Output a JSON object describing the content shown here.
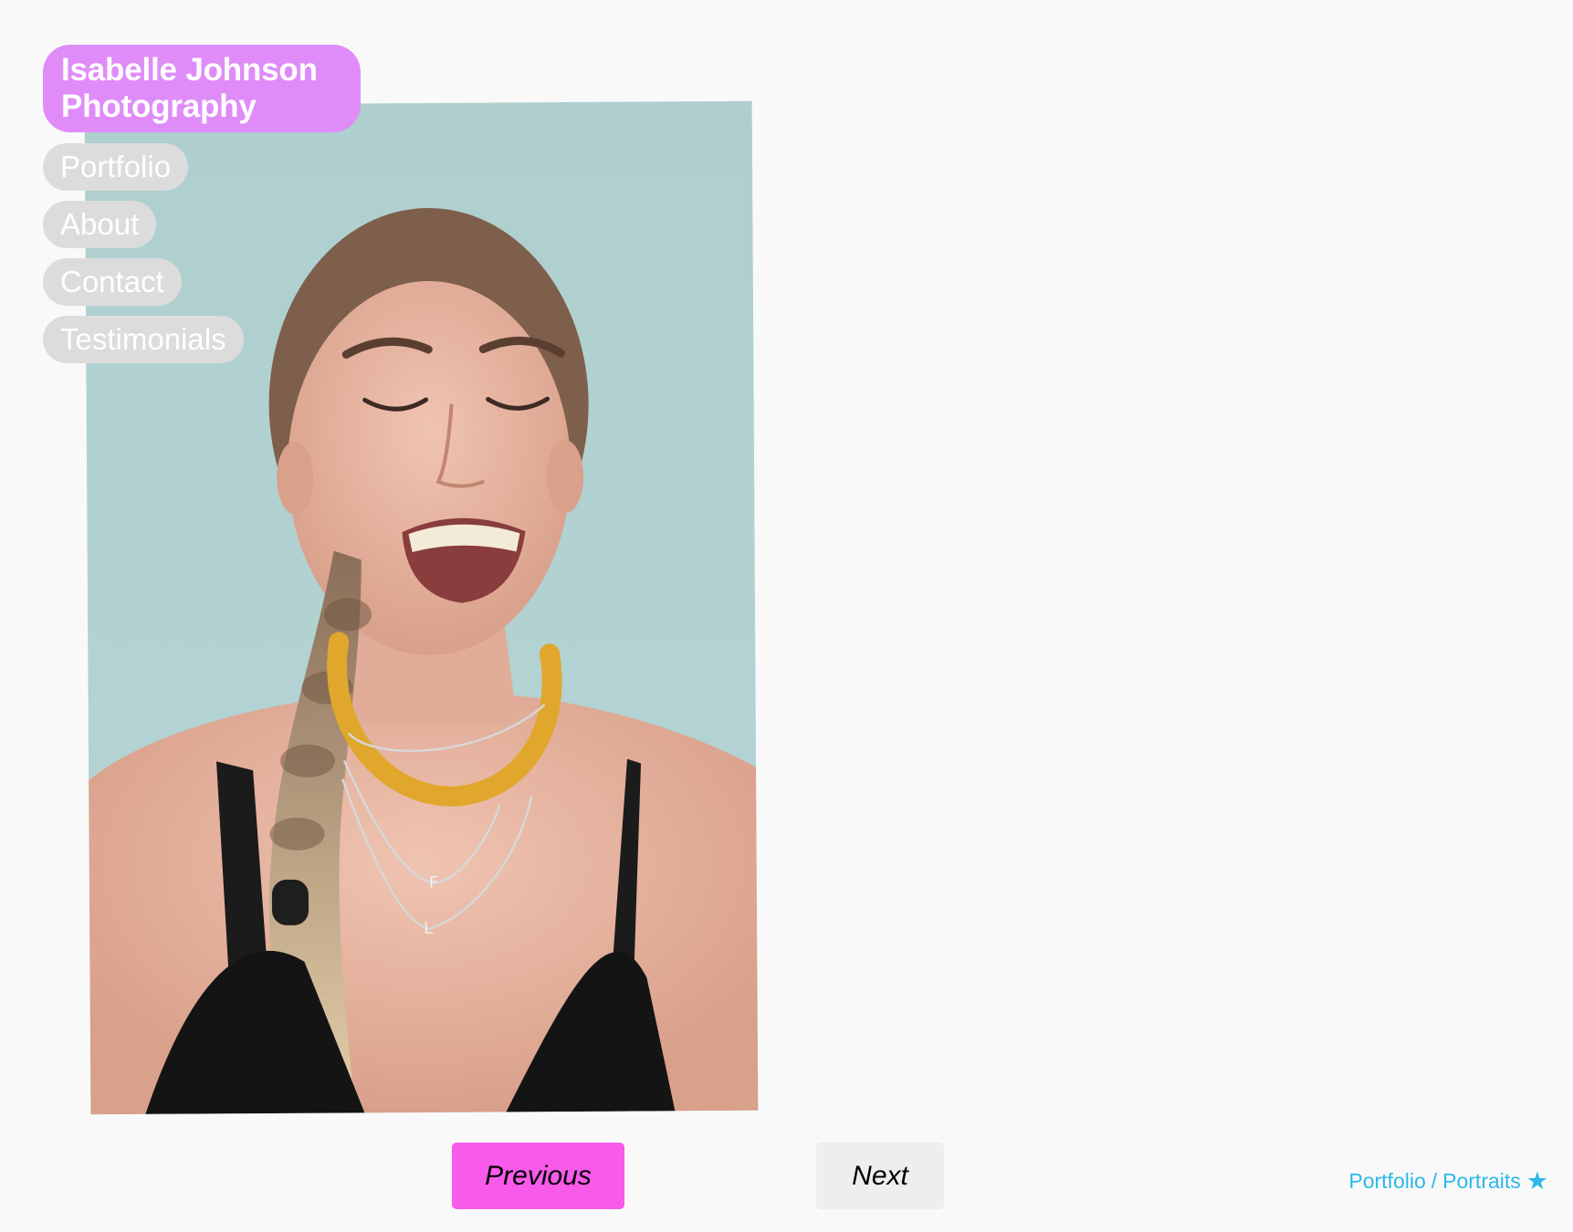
{
  "site": {
    "title": "Isabelle Johnson Photography",
    "title_color": "#df8cf8"
  },
  "nav": {
    "items": [
      {
        "label": "Portfolio"
      },
      {
        "label": "About"
      },
      {
        "label": "Contact"
      },
      {
        "label": "Testimonials"
      }
    ],
    "item_bg": "#dcdcdc"
  },
  "photo": {
    "subject": "portrait-photo"
  },
  "pager": {
    "previous_label": "Previous",
    "previous_color": "#f85ae9",
    "next_label": "Next",
    "next_color": "#eeeeee"
  },
  "breadcrumb": {
    "section": "Portfolio",
    "separator": "/",
    "page": "Portraits",
    "icon": "star-icon",
    "color": "#2cb8ea"
  }
}
